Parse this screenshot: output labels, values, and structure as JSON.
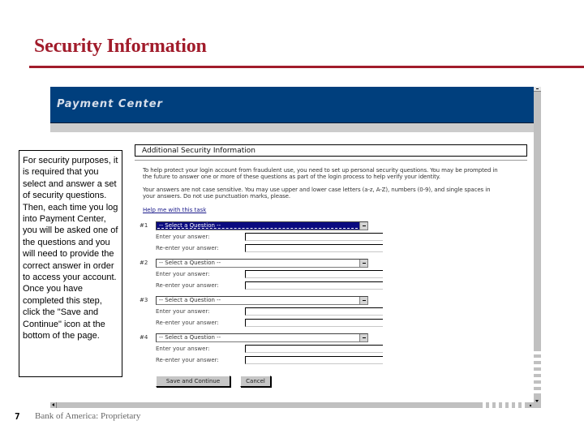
{
  "slide": {
    "title": "Security Information",
    "page_number": "7",
    "footer": "Bank of America: Proprietary",
    "accent_color": "#a11c2b"
  },
  "callout": {
    "text": "For security purposes, it is required that you select and answer a set of  security questions.  Then, each time you log into Payment Center, you will be asked one of the questions and you will need to provide the correct answer in order to access your account.  Once you have completed this step,  click the \"Save and Continue\" icon at the bottom of the page."
  },
  "app": {
    "banner_title": "Payment Center",
    "banner_color": "#003f7d",
    "section_title": "Additional Security Information",
    "intro_paragraph": "To help protect your login account from fraudulent use, you need to set up personal security questions. You may be prompted in the future to answer one or more of these questions as part of the login process to help verify your identity.",
    "rules_paragraph": "Your answers are not case sensitive. You may use upper and lower case letters (a-z, A-Z), numbers (0-9), and single spaces in your answers. Do not use punctuation marks, please.",
    "help_link": "Help me with this task",
    "questions": [
      {
        "number": "#1",
        "placeholder": "-- Select a Question --",
        "answer_label": "Enter your answer:",
        "reenter_label": "Re-enter your answer:",
        "answer_value": "",
        "reenter_value": "",
        "active": true
      },
      {
        "number": "#2",
        "placeholder": "-- Select a Question --",
        "answer_label": "Enter your answer:",
        "reenter_label": "Re-enter your answer:",
        "answer_value": "",
        "reenter_value": "",
        "active": false
      },
      {
        "number": "#3",
        "placeholder": "-- Select a Question --",
        "answer_label": "Enter your answer:",
        "reenter_label": "Re-enter your answer:",
        "answer_value": "",
        "reenter_value": "",
        "active": false
      },
      {
        "number": "#4",
        "placeholder": "-- Select a Question --",
        "answer_label": "Enter your answer:",
        "reenter_label": "Re-enter your answer:",
        "answer_value": "",
        "reenter_value": "",
        "active": false
      }
    ],
    "save_button": "Save and Continue",
    "cancel_button": "Cancel"
  }
}
